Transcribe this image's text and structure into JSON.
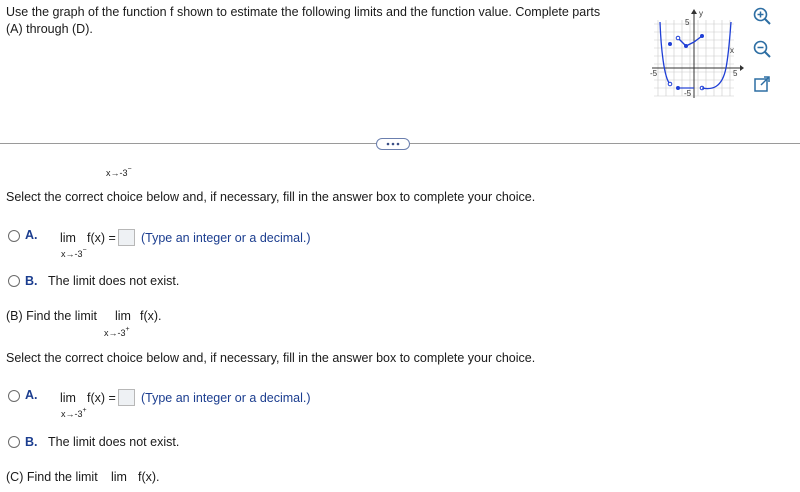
{
  "question": {
    "text": "Use the graph of the function f shown to estimate the following limits and the function value. Complete parts (A) through (D)."
  },
  "graph": {
    "x_label": "x",
    "y_label": "y",
    "tick_top": "5",
    "tick_bottom": "-5",
    "tick_left": "-5",
    "tick_right": "5"
  },
  "toolbar": {
    "zoom_in_icon": "zoom-in-icon",
    "zoom_out_icon": "zoom-out-icon",
    "popout_icon": "external-link-icon"
  },
  "more_button": {
    "label": "..."
  },
  "part_a": {
    "sub_under_limit": "x→-3",
    "sub_sup": "−",
    "instruction": "Select the correct choice below and, if necessary, fill in the answer box to complete your choice.",
    "choice_a_letter": "A.",
    "choice_a_lim": "lim",
    "choice_a_fx": "f(x) =",
    "choice_a_sub": "x→-3",
    "choice_a_sup": "−",
    "choice_a_hint": "(Type an integer or a decimal.)",
    "choice_b_letter": "B.",
    "choice_b_text": "The limit does not exist."
  },
  "part_b": {
    "heading": "(B) Find the limit",
    "lim": "lim",
    "fx": "f(x).",
    "sub": "x→-3",
    "sup": "+",
    "instruction": "Select the correct choice below and, if necessary, fill in the answer box to complete your choice.",
    "choice_a_letter": "A.",
    "choice_a_lim": "lim",
    "choice_a_fx": "f(x) =",
    "choice_a_sub": "x→-3",
    "choice_a_sup": "+",
    "choice_a_hint": "(Type an integer or a decimal.)",
    "choice_b_letter": "B.",
    "choice_b_text": "The limit does not exist."
  },
  "part_c": {
    "heading": "(C) Find the limit",
    "lim": "lim",
    "fx": "f(x)."
  }
}
